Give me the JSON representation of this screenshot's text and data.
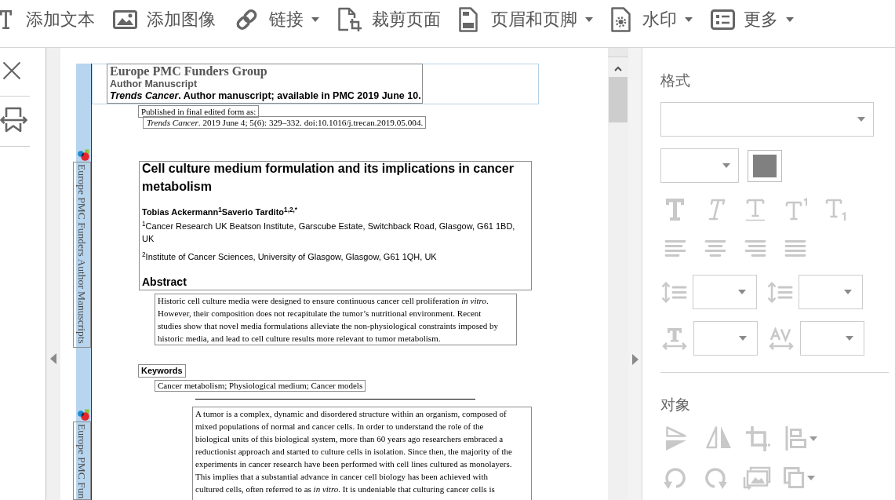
{
  "toolbar": {
    "items": [
      {
        "kind": "text",
        "label": "添加文本",
        "dropdown": false
      },
      {
        "kind": "image",
        "label": "添加图像",
        "dropdown": false
      },
      {
        "kind": "link",
        "label": "链接",
        "dropdown": true
      },
      {
        "kind": "crop",
        "label": "裁剪页面",
        "dropdown": false
      },
      {
        "kind": "header_footer",
        "label": "页眉和页脚",
        "dropdown": true
      },
      {
        "kind": "watermark",
        "label": "水印",
        "dropdown": true
      },
      {
        "kind": "more",
        "label": "更多",
        "dropdown": true
      }
    ]
  },
  "document": {
    "side_labels": [
      "Europe PMC Funders Author Manuscripts",
      "Europe PMC Fun"
    ],
    "header": {
      "group": "Europe PMC Funders Group",
      "manuscript": "Author Manuscript",
      "availability": "*Trends Cancer*. Author manuscript; available in PMC 2019 June 10."
    },
    "published_label": "Published in final edited form as:",
    "citation": "*Trends Cancer*. 2019 June 4; 5(6): 329–332. doi:10.1016/j.trecan.2019.05.004.",
    "title": "Cell culture medium formulation and its implications in cancer metabolism",
    "authors": "Tobias Ackermann$^{1}$Saverio Tardito$^{1,2,*}$",
    "affiliations": [
      "$^{1}$Cancer Research UK Beatson Institute, Garscube Estate, Switchback Road, Glasgow, G61 1BD, UK",
      "$^{2}$Institute of Cancer Sciences, University of Glasgow, Glasgow, G61 1QH, UK"
    ],
    "abstract_heading": "Abstract",
    "abstract": "Historic cell culture media were designed to ensure continuous cancer cell proliferation *in vitro*.\nHowever, their composition does not recapitulate the tumor’s nutritional environment. Recent\nstudies show that novel media formulations alleviate the non-physiological constraints imposed by\nhistoric media, and lead to cell culture results more relevant to tumor metabolism.",
    "keywords_heading": "Keywords",
    "keywords": "Cancer metabolism; Physiological medium; Cancer models",
    "body": "A tumor is a complex, dynamic and disordered structure within an organism, composed of\nmixed populations of normal and cancer cells. In order to understand the role of the\nbiological units of this biological system, more than 60 years ago researchers embraced a\nreductionist approach and started to culture cells in isolation. Since then, the majority of the\nexperiments in cancer research have been performed with cell lines cultured as monolayers.\nThis implies that a substantial advance in cancer cell biology has been achieved with\ncultured cells, often referred to as *in vitro*. It is undeniable that culturing cancer cells is"
  },
  "format_panel": {
    "title": "格式",
    "color_swatch": {
      "color": "#808080"
    },
    "text_styles": [
      {
        "kind": "bold",
        "disabled": true
      },
      {
        "kind": "italic",
        "disabled": true
      },
      {
        "kind": "underline",
        "disabled": true
      },
      {
        "kind": "superscript",
        "disabled": true
      },
      {
        "kind": "subscript",
        "disabled": true
      }
    ],
    "alignment": [
      {
        "kind": "left",
        "disabled": true
      },
      {
        "kind": "center",
        "disabled": true
      },
      {
        "kind": "right",
        "disabled": true
      },
      {
        "kind": "justify",
        "disabled": true
      }
    ],
    "spacing": [
      {
        "kind": "line_spacing",
        "disabled": true
      },
      {
        "kind": "paragraph_spacing",
        "disabled": true
      },
      {
        "kind": "char_scale",
        "disabled": true
      },
      {
        "kind": "char_spacing",
        "disabled": true
      }
    ]
  },
  "object_panel": {
    "title": "对象",
    "tools": [
      {
        "kind": "flip_vertical",
        "disabled": true,
        "dropdown": false
      },
      {
        "kind": "flip_horizontal",
        "disabled": true,
        "dropdown": false
      },
      {
        "kind": "crop",
        "disabled": true,
        "dropdown": false
      },
      {
        "kind": "align",
        "disabled": true,
        "dropdown": true
      },
      {
        "kind": "rotate_left",
        "disabled": true,
        "dropdown": false
      },
      {
        "kind": "rotate_right",
        "disabled": true,
        "dropdown": false
      },
      {
        "kind": "replace_image",
        "disabled": true,
        "dropdown": false
      },
      {
        "kind": "arrange",
        "disabled": true,
        "dropdown": true
      }
    ]
  }
}
